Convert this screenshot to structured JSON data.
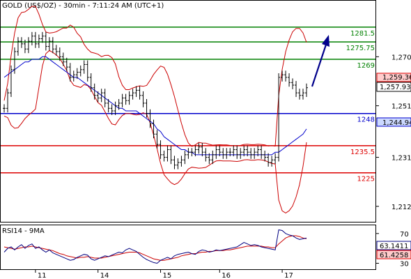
{
  "header": {
    "main_title": "GOLD (US$/OZ) - 30min - 7:11:24 AM (UTC+1)",
    "rsi_title": "RSI14 - 9MA"
  },
  "colors": {
    "price_bar": "#000000",
    "bollinger": "#cc0000",
    "moving_average": "#0000cc",
    "support_resistance_green": "#008000",
    "support_resistance_red": "#dd0000",
    "support_blue": "#0000cc",
    "arrow": "#00008b",
    "rsi_line": "#000080",
    "rsi_ma": "#cc0000"
  },
  "badges": {
    "upper_band": "1,259.36",
    "last_price": "1,257.93",
    "ma_value": "1,244.94",
    "rsi_value": "63.1411",
    "rsi_ma_value": "61.4258"
  },
  "chart_data": [
    {
      "type": "line",
      "title": "GOLD (US$/OZ) - 30min - 7:11:24 AM (UTC+1)",
      "x_tick_labels": [
        "11",
        "14",
        "15",
        "16",
        "17"
      ],
      "y_tick_labels": [
        "1,270",
        "1,251",
        "1,231",
        "1,212"
      ],
      "y_ticks": [
        1270,
        1251,
        1231,
        1212
      ],
      "ylim": [
        1206,
        1292
      ],
      "levels": [
        {
          "label": "1281.5",
          "value": 1281.5,
          "color": "green"
        },
        {
          "label": "1275.75",
          "value": 1275.75,
          "color": "green"
        },
        {
          "label": "1269",
          "value": 1269,
          "color": "green"
        },
        {
          "label": "1248",
          "value": 1248,
          "color": "blue"
        },
        {
          "label": "1235.5",
          "value": 1235.5,
          "color": "red"
        },
        {
          "label": "1225",
          "value": 1225,
          "color": "red"
        }
      ],
      "series": [
        {
          "values": [
            1250,
            1256,
            1265,
            1272,
            1276,
            1275,
            1273,
            1276,
            1278,
            1275,
            1277,
            1278,
            1274,
            1276,
            1273,
            1272,
            1270,
            1268,
            1266,
            1262,
            1263,
            1264,
            1265,
            1267,
            1262,
            1258,
            1255,
            1254,
            1256,
            1252,
            1250,
            1249,
            1251,
            1252,
            1254,
            1253,
            1255,
            1256,
            1257,
            1255,
            1252,
            1248,
            1244,
            1240,
            1236,
            1232,
            1231,
            1234,
            1230,
            1228,
            1229,
            1230,
            1232,
            1233,
            1233,
            1234,
            1235,
            1233,
            1231,
            1230,
            1232,
            1234,
            1233,
            1232,
            1233,
            1233,
            1234,
            1232,
            1233,
            1234,
            1233,
            1232,
            1233,
            1234,
            1232,
            1231,
            1229,
            1230,
            1231,
            1262,
            1263,
            1262,
            1260,
            1259,
            1256,
            1255,
            1256,
            1258
          ]
        },
        {
          "values": [
            1262,
            1263,
            1264,
            1265,
            1266,
            1267,
            1268,
            1268,
            1269,
            1269,
            1269,
            1270,
            1270,
            1269,
            1268,
            1267,
            1266,
            1265,
            1264,
            1263,
            1262,
            1262,
            1261,
            1260,
            1259,
            1258,
            1257,
            1256,
            1255,
            1254,
            1253,
            1252,
            1251,
            1250,
            1250,
            1249,
            1249,
            1249,
            1249,
            1248,
            1247,
            1246,
            1245,
            1244,
            1242,
            1241,
            1239,
            1238,
            1237,
            1236,
            1235,
            1234,
            1234,
            1233,
            1233,
            1232,
            1232,
            1232,
            1232,
            1232,
            1232,
            1232,
            1232,
            1232,
            1232,
            1232,
            1232,
            1232,
            1232,
            1232,
            1232,
            1232,
            1232,
            1232,
            1232,
            1232,
            1232,
            1232,
            1233,
            1233,
            1234,
            1235,
            1236,
            1237,
            1238,
            1239,
            1240,
            1242
          ]
        }
      ]
    },
    {
      "type": "line",
      "title": "RSI14 - 9MA",
      "y_tick_labels": [
        "70",
        "30"
      ],
      "y_ticks": [
        70,
        30
      ],
      "ylim": [
        22,
        82
      ],
      "series": [
        {
          "values": [
            45,
            50,
            52,
            48,
            52,
            55,
            50,
            54,
            56,
            50,
            52,
            48,
            45,
            48,
            44,
            42,
            40,
            38,
            36,
            34,
            35,
            38,
            40,
            42,
            41,
            36,
            34,
            36,
            38,
            40,
            39,
            41,
            43,
            45,
            44,
            48,
            50,
            48,
            46,
            42,
            38,
            35,
            33,
            31,
            30,
            34,
            36,
            38,
            36,
            40,
            42,
            43,
            44,
            45,
            43,
            42,
            46,
            48,
            47,
            45,
            46,
            48,
            47,
            48,
            49,
            50,
            51,
            52,
            55,
            58,
            56,
            54,
            55,
            54,
            52,
            51,
            50,
            49,
            48,
            75,
            74,
            70,
            68,
            67,
            64,
            62,
            63,
            64
          ]
        },
        {
          "values": [
            52,
            51,
            50,
            49,
            50,
            51,
            52,
            52,
            53,
            52,
            51,
            50,
            49,
            48,
            47,
            45,
            43,
            42,
            40,
            39,
            38,
            37,
            38,
            38,
            39,
            38,
            37,
            37,
            37,
            38,
            39,
            40,
            41,
            42,
            43,
            44,
            45,
            45,
            45,
            44,
            42,
            40,
            38,
            36,
            35,
            34,
            34,
            35,
            36,
            37,
            38,
            40,
            41,
            42,
            43,
            43,
            44,
            45,
            45,
            46,
            46,
            47,
            47,
            47,
            48,
            48,
            49,
            50,
            51,
            52,
            53,
            53,
            53,
            53,
            53,
            52,
            52,
            51,
            51,
            56,
            60,
            64,
            66,
            67,
            67,
            66,
            64,
            63
          ]
        }
      ]
    }
  ]
}
